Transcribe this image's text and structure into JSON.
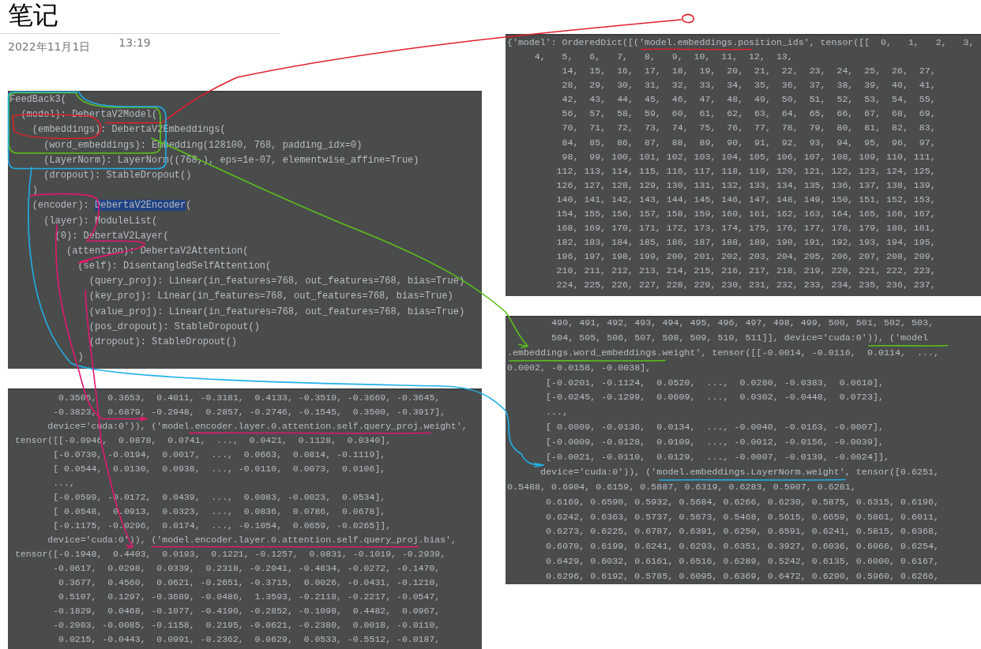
{
  "page": {
    "title": "笔记",
    "date": "2022年11月1日",
    "time": "13:19"
  },
  "panels": [
    {
      "lines": [
        "FeedBack3(",
        "  (model): DebertaV2Model(",
        "    (embeddings): DebertaV2Embeddings(",
        "      (word_embeddings): Embedding(128100, 768, padding_idx=0)",
        "      (LayerNorm): LayerNorm((768,), eps=1e-07, elementwise_affine=True)",
        "      (dropout): StableDropout()",
        "    )",
        {
          "segments": [
            {
              "text": "    (encoder): ",
              "selected": false
            },
            {
              "text": "DebertaV2Encoder",
              "selected": true
            },
            {
              "text": "(",
              "selected": false
            }
          ]
        },
        "      (layer): ModuleList(",
        "        (0): DebertaV2Layer(",
        "          (attention): DebertaV2Attention(",
        "            (self): DisentangledSelfAttention(",
        "              (query_proj): Linear(in_features=768, out_features=768, bias=True)",
        "              (key_proj): Linear(in_features=768, out_features=768, bias=True)",
        "              (value_proj): Linear(in_features=768, out_features=768, bias=True)",
        "              (pos_dropout): StableDropout()",
        "              (dropout): StableDropout()",
        "            )"
      ]
    },
    {
      "lines": [
        "{'model': OrderedDict([('model.embeddings.position_ids', tensor([[  0,   1,   2,   3,",
        "     4,   5,   6,   7,   8,   9,  10,  11,  12,  13,",
        "          14,  15,  16,  17,  18,  19,  20,  21,  22,  23,  24,  25,  26,  27,",
        "          28,  29,  30,  31,  32,  33,  34,  35,  36,  37,  38,  39,  40,  41,",
        "          42,  43,  44,  45,  46,  47,  48,  49,  50,  51,  52,  53,  54,  55,",
        "          56,  57,  58,  59,  60,  61,  62,  63,  64,  65,  66,  67,  68,  69,",
        "          70,  71,  72,  73,  74,  75,  76,  77,  78,  79,  80,  81,  82,  83,",
        "          84,  85,  86,  87,  88,  89,  90,  91,  92,  93,  94,  95,  96,  97,",
        "          98,  99, 100, 101, 102, 103, 104, 105, 106, 107, 108, 109, 110, 111,",
        "         112, 113, 114, 115, 116, 117, 118, 119, 120, 121, 122, 123, 124, 125,",
        "         126, 127, 128, 129, 130, 131, 132, 133, 134, 135, 136, 137, 138, 139,",
        "         140, 141, 142, 143, 144, 145, 146, 147, 148, 149, 150, 151, 152, 153,",
        "         154, 155, 156, 157, 158, 159, 160, 161, 162, 163, 164, 165, 166, 167,",
        "         168, 169, 170, 171, 172, 173, 174, 175, 176, 177, 178, 179, 180, 181,",
        "         182, 183, 184, 185, 186, 187, 188, 189, 190, 191, 192, 193, 194, 195,",
        "         196, 197, 198, 199, 200, 201, 202, 203, 204, 205, 206, 207, 208, 209,",
        "         210, 211, 212, 213, 214, 215, 216, 217, 218, 219, 220, 221, 222, 223,",
        "         224, 225, 226, 227, 228, 229, 230, 231, 232, 233, 234, 235, 236, 237,"
      ]
    },
    {
      "lines": [
        "        490, 491, 492, 493, 494, 495, 496, 497, 498, 499, 500, 501, 502, 503,",
        "        504, 505, 506, 507, 508, 509, 510, 511]], device='cuda:0')), ('model",
        ".embeddings.word_embeddings.weight', tensor([[-0.0014, -0.0116,  0.0114,  ...,",
        "0.0002, -0.0158, -0.0038],",
        "       [-0.0201, -0.1124,  0.0520,  ...,  0.0280, -0.0383,  0.0610],",
        "       [-0.0245, -0.1299,  0.0609,  ...,  0.0302, -0.0448,  0.0723],",
        "       ...,",
        "       [ 0.0009, -0.0136,  0.0134,  ..., -0.0040, -0.0163, -0.0007],",
        "       [-0.0009, -0.0128,  0.0109,  ..., -0.0012, -0.0156, -0.0039],",
        "       [-0.0021, -0.0110,  0.0129,  ..., -0.0007, -0.0139, -0.0024]],",
        "      device='cuda:0')), ('model.embeddings.LayerNorm.weight', tensor([0.6251,",
        "0.5488, 0.6904, 0.6159, 0.5887, 0.6319, 0.6283, 0.5907, 0.6281,",
        "       0.6169, 0.6590, 0.5932, 0.5684, 0.6266, 0.6230, 0.5875, 0.6315, 0.6196,",
        "       0.6242, 0.6363, 0.5737, 0.5673, 0.5468, 0.5615, 0.6659, 0.5861, 0.6011,",
        "       0.6273, 0.6225, 0.6787, 0.6391, 0.6250, 0.6591, 0.6241, 0.5815, 0.6368,",
        "       0.6070, 0.6199, 0.6241, 0.6293, 0.6351, 0.3927, 0.6036, 0.6066, 0.6254,",
        "       0.6429, 0.6032, 0.6161, 0.6516, 0.6289, 0.5242, 0.6135, 0.6000, 0.6167,",
        "       0.6296, 0.6192, 0.5785, 0.6095, 0.6369, 0.6472, 0.6290, 0.5960, 0.6266,"
      ]
    },
    {
      "lines": [
        "         0.3506,  0.3653,  0.4011, -0.3181,  0.4133, -0.3510, -0.3669, -0.3645,",
        "        -0.3823,  0.6879, -0.2948,  0.2857, -0.2746, -0.1545,  0.3500, -0.3917],",
        "       device='cuda:0')), ('model.encoder.layer.0.attention.self.query_proj.weight',",
        " tensor([[-0.0946,  0.0878,  0.0741,  ...,  0.0421,  0.1128,  0.0340],",
        "        [-0.0730, -0.0194,  0.0017,  ...,  0.0663,  0.0814, -0.1119],",
        "        [ 0.0544,  0.0130,  0.0938,  ..., -0.0110,  0.0073,  0.0106],",
        "        ...,",
        "        [-0.0599, -0.0172,  0.0439,  ...,  0.0083, -0.0023,  0.0534],",
        "        [ 0.0548,  0.0913,  0.0323,  ...,  0.0836,  0.0786,  0.0678],",
        "        [-0.1175, -0.0296,  0.0174,  ..., -0.1054,  0.0659, -0.0265]],",
        "       device='cuda:0')), ('model.encoder.layer.0.attention.self.query_proj.bias',",
        " tensor([-0.1948,  0.4403,  0.0193,  0.1221, -0.1257,  0.0831, -0.1019, -0.2939,",
        "        -0.0617,  0.0298,  0.0339,  0.2318, -0.2041, -0.4834, -0.0272, -0.1470,",
        "         0.3677,  0.4560,  0.0621, -0.2651, -0.3715,  0.0026, -0.0431, -0.1210,",
        "         0.5107,  0.1297, -0.3689, -0.0486,  1.3593, -0.2118, -0.2217, -0.0547,",
        "        -0.1829,  0.0468, -0.1077, -0.4190, -0.2852, -0.1098,  0.4482,  0.0967,",
        "        -0.2003, -0.0085, -0.1158,  0.2195, -0.0621, -0.2380,  0.0018, -0.0110,",
        "         0.0215, -0.0443,  0.0991, -0.2362,  0.0629,  0.0533, -0.5512, -0.0187,"
      ]
    }
  ]
}
